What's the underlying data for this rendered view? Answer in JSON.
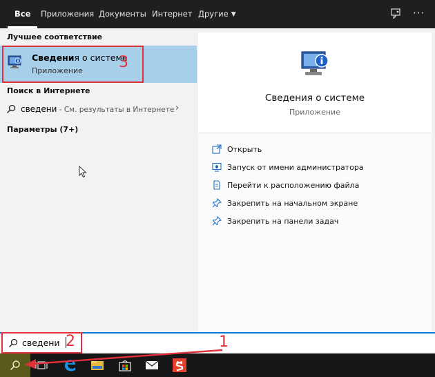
{
  "tabs": [
    {
      "label": "Все",
      "active": true
    },
    {
      "label": "Приложения"
    },
    {
      "label": "Документы"
    },
    {
      "label": "Интернет"
    },
    {
      "label": "Другие"
    }
  ],
  "left": {
    "best_match_header": "Лучшее соответствие",
    "best": {
      "title_bold": "Сведени",
      "title_rest": "я о системе",
      "subtitle": "Приложение"
    },
    "web_header": "Поиск в Интернете",
    "web": {
      "query": "сведени",
      "hint": " - См. результаты в Интернете"
    },
    "params_header": "Параметры (7+)"
  },
  "right": {
    "app_name": "Сведения о системе",
    "app_kind": "Приложение",
    "actions": [
      {
        "label": "Открыть",
        "icon": "open-icon"
      },
      {
        "label": "Запуск от имени администратора",
        "icon": "admin-icon"
      },
      {
        "label": "Перейти к расположению файла",
        "icon": "file-location-icon"
      },
      {
        "label": "Закрепить на начальном экране",
        "icon": "pin-icon"
      },
      {
        "label": "Закрепить на панели задач",
        "icon": "pin-icon"
      }
    ]
  },
  "search": {
    "value": "сведени"
  },
  "annotations": {
    "one": "1",
    "two": "2",
    "three": "3"
  },
  "colors": {
    "accent": "#0078d7",
    "highlight": "#a8cfea",
    "annotation_red": "#e0313a",
    "taskbar": "#161616"
  }
}
